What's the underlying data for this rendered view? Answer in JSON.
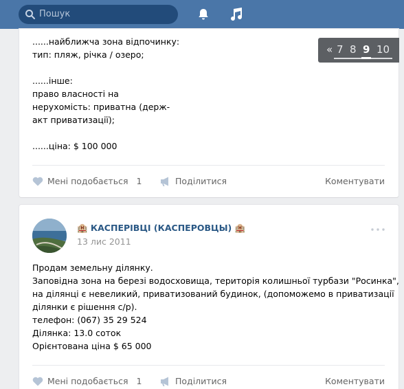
{
  "header": {
    "search_placeholder": "Пошук",
    "icons": [
      "search-icon",
      "bell-icon",
      "music-icon"
    ]
  },
  "post1": {
    "lines": [
      "......найближча зона відпочинку:",
      "тип: пляж, річка / озеро;",
      "",
      "......інше:",
      "право власності на",
      "нерухомість: приватна (держ-",
      "акт приватизації);",
      "",
      "......ціна: $ 100 000"
    ],
    "like_label": "Мені подобається",
    "like_count": "1",
    "share_label": "Поділитися",
    "comment_label": "Коментувати"
  },
  "post2": {
    "author": "🏨 КАСПЕРІВЦІ (КАСПЕРОВЦЫ) 🏨",
    "date": "13 лис 2011",
    "lines": [
      "Продам земельну ділянку.",
      "Заповідна зона на березі водосховища, територія колишньої турбази \"Росинка\",",
      "на ділянці є невеликий, приватизований будинок, (допоможемо в приватизації",
      "ділянки є рішення с/р).",
      "телефон: (067) 35 29 524",
      "Ділянка: 13.0 соток",
      "Орієнтована ціна $ 65 000"
    ],
    "like_label": "Мені подобається",
    "like_count": "1",
    "share_label": "Поділитися",
    "comment_label": "Коментувати"
  },
  "pager": {
    "prev": "«",
    "pages": [
      "7",
      "8",
      "9",
      "10"
    ],
    "current": "9"
  },
  "colors": {
    "header_bg": "#4a76a8",
    "link": "#2a5885",
    "page_bg": "#edeef0"
  }
}
